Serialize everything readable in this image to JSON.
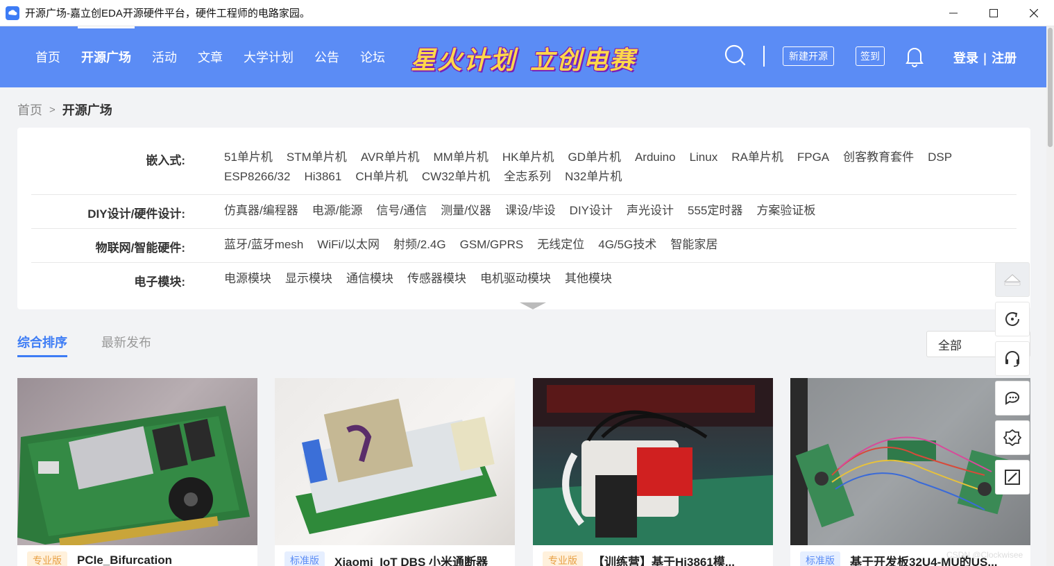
{
  "window": {
    "title": "开源广场-嘉立创EDA开源硬件平台，硬件工程师的电路家园。"
  },
  "nav": {
    "items": [
      "首页",
      "开源广场",
      "活动",
      "文章",
      "大学计划",
      "公告",
      "论坛"
    ],
    "active_index": 1
  },
  "promos": [
    "星火计划",
    "立创电赛"
  ],
  "header_actions": {
    "new_project": "新建开源",
    "sign_in": "签到",
    "login": "登录 | 注册"
  },
  "breadcrumb": {
    "home": "首页",
    "separator": ">",
    "current": "开源广场"
  },
  "categories": [
    {
      "label": "嵌入式:",
      "items": [
        "51单片机",
        "STM单片机",
        "AVR单片机",
        "MM单片机",
        "HK单片机",
        "GD单片机",
        "Arduino",
        "Linux",
        "RA单片机",
        "FPGA",
        "创客教育套件",
        "DSP",
        "ESP8266/32",
        "Hi3861",
        "CH单片机",
        "CW32单片机",
        "全志系列",
        "N32单片机"
      ]
    },
    {
      "label": "DIY设计/硬件设计:",
      "items": [
        "仿真器/编程器",
        "电源/能源",
        "信号/通信",
        "测量/仪器",
        "课设/毕设",
        "DIY设计",
        "声光设计",
        "555定时器",
        "方案验证板"
      ]
    },
    {
      "label": "物联网/智能硬件:",
      "items": [
        "蓝牙/蓝牙mesh",
        "WiFi/以太网",
        "射频/2.4G",
        "GSM/GPRS",
        "无线定位",
        "4G/5G技术",
        "智能家居"
      ]
    },
    {
      "label": "电子模块:",
      "items": [
        "电源模块",
        "显示模块",
        "通信模块",
        "传感器模块",
        "电机驱动模块",
        "其他模块"
      ]
    }
  ],
  "sort": {
    "tabs": [
      "综合排序",
      "最新发布"
    ],
    "filter_value": "全部"
  },
  "cards": [
    {
      "badge": "专业版",
      "badge_type": "pro",
      "title": "PCIe_Bifurcation"
    },
    {
      "badge": "标准版",
      "badge_type": "std",
      "title": "Xiaomi_IoT DBS 小米通断器"
    },
    {
      "badge": "专业版",
      "badge_type": "pro",
      "title": "【训练营】基于Hi3861模..."
    },
    {
      "badge": "标准版",
      "badge_type": "std",
      "title": "基于开发板32U4-MU的US..."
    }
  ],
  "watermark": "CSDN @Clockwisee",
  "colors": {
    "header_bg": "#5b8cf5",
    "accent": "#3d7cf5",
    "promo_text": "#ffd84a"
  }
}
